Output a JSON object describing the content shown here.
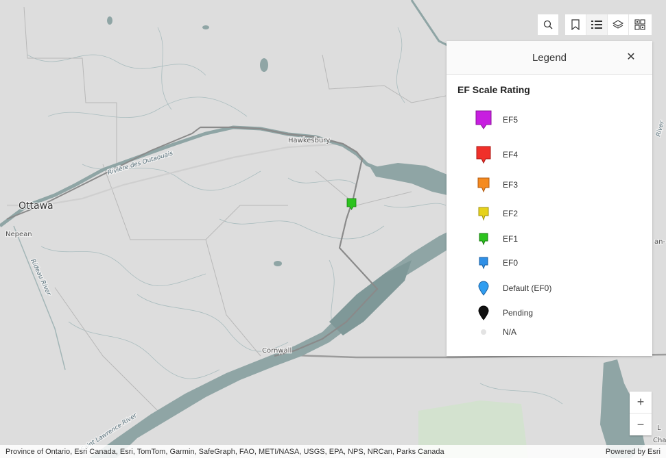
{
  "toolbar": {
    "search": {
      "icon": "search-icon"
    },
    "bookmarks": {
      "icon": "bookmark-icon"
    },
    "legend": {
      "icon": "legend-list-icon"
    },
    "layers": {
      "icon": "layers-icon"
    },
    "basemap": {
      "icon": "basemap-gallery-icon"
    }
  },
  "legend": {
    "title": "Legend",
    "close_icon": "close-icon",
    "layer_title": "EF Scale Rating",
    "items": [
      {
        "label": "EF5",
        "color": "#c71ee0"
      },
      {
        "label": "EF4",
        "color": "#f0302a"
      },
      {
        "label": "EF3",
        "color": "#f58a1f"
      },
      {
        "label": "EF2",
        "color": "#e6d21a"
      },
      {
        "label": "EF1",
        "color": "#2cc31e"
      },
      {
        "label": "EF0",
        "color": "#2f8fe6"
      },
      {
        "label": "Default (EF0)",
        "color": "#2f9df0"
      },
      {
        "label": "Pending",
        "color": "#111111"
      },
      {
        "label": "N/A",
        "color": "#e3e3e3"
      }
    ]
  },
  "map": {
    "labels": {
      "ottawa": "Ottawa",
      "nepean": "Nepean",
      "hawkesbury": "Hawkesbury",
      "cornwall": "Cornwall",
      "riviere": "Rivière des Outaouais",
      "rideau": "Rideau River",
      "stlawrence": "Saint Lawrence River",
      "edge_river": "River",
      "edge_an": "an-",
      "edge_l": "L",
      "edge_char": "Char"
    },
    "colors": {
      "land": "#dcdcdc",
      "water": "#8fa5a5",
      "roads": "#c6c6c6",
      "route": "#8a8a8a",
      "park": "#cfe0c9"
    },
    "marker": {
      "label": "EF1",
      "color": "#2cc31e"
    }
  },
  "zoom": {
    "in_label": "+",
    "out_label": "−"
  },
  "attribution": {
    "text": "Province of Ontario, Esri Canada, Esri, TomTom, Garmin, SafeGraph, FAO, METI/NASA, USGS, EPA, NPS, NRCan, Parks Canada",
    "powered": "Powered by Esri"
  }
}
